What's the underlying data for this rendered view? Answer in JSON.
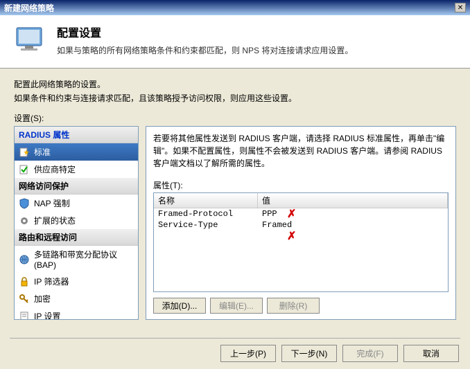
{
  "window": {
    "title": "新建网络策略"
  },
  "header": {
    "title": "配置设置",
    "subtitle": "如果与策略的所有网络策略条件和约束都匹配，则 NPS 将对连接请求应用设置。"
  },
  "content": {
    "intro1": "配置此网络策略的设置。",
    "intro2": "如果条件和约束与连接请求匹配，且该策略授予访问权限，则应用这些设置。",
    "settings_label": "设置(S):"
  },
  "sidebar": {
    "groups": [
      {
        "title": "RADIUS 属性",
        "class": "radius",
        "items": [
          {
            "label": "标准",
            "icon": "doc-star",
            "selected": true
          },
          {
            "label": "供应商特定",
            "icon": "doc-check"
          }
        ]
      },
      {
        "title": "网络访问保护",
        "items": [
          {
            "label": "NAP 强制",
            "icon": "shield"
          },
          {
            "label": "扩展的状态",
            "icon": "gear"
          }
        ]
      },
      {
        "title": "路由和远程访问",
        "items": [
          {
            "label": "多链路和带宽分配协议(BAP)",
            "icon": "globe"
          },
          {
            "label": "IP 筛选器",
            "icon": "lock"
          },
          {
            "label": "加密",
            "icon": "key"
          },
          {
            "label": "IP 设置",
            "icon": "doc"
          }
        ]
      }
    ]
  },
  "panel": {
    "instruction": "若要将其他属性发送到 RADIUS 客户端，请选择 RADIUS 标准属性，再单击\"编辑\"。如果不配置属性，则属性不会被发送到 RADIUS 客户端。请参阅 RADIUS 客户端文档以了解所需的属性。",
    "attr_label": "属性(T):",
    "columns": {
      "name": "名称",
      "value": "值"
    },
    "rows": [
      {
        "name": "Framed-Protocol",
        "value": "PPP"
      },
      {
        "name": "Service-Type",
        "value": "Framed"
      }
    ],
    "buttons": {
      "add": "添加(D)...",
      "edit": "编辑(E)...",
      "delete": "删除(R)"
    }
  },
  "footer": {
    "back": "上一步(P)",
    "next": "下一步(N)",
    "finish": "完成(F)",
    "cancel": "取消"
  }
}
